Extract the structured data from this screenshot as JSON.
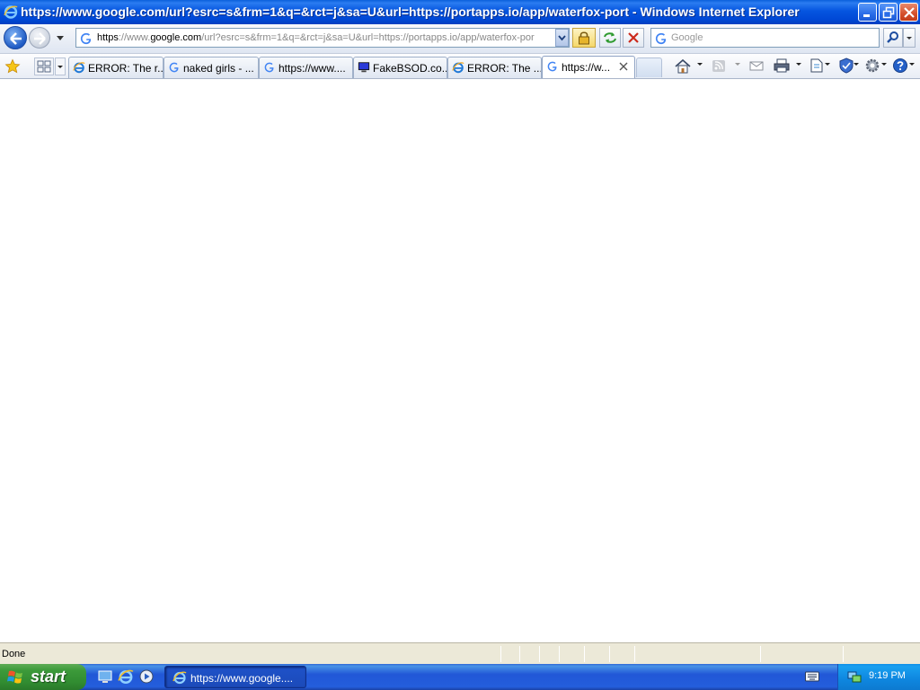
{
  "window": {
    "title": "https://www.google.com/url?esrc=s&frm=1&q=&rct=j&sa=U&url=https://portapps.io/app/waterfox-port - Windows Internet Explorer"
  },
  "navigation": {
    "url_scheme": "https",
    "url_sub": "://www.",
    "url_domain": "google.com",
    "url_rest": "/url?esrc=s&frm=1&q=&rct=j&sa=U&url=https://portapps.io/app/waterfox-por",
    "search_placeholder": "Google"
  },
  "tabs": [
    {
      "label": "ERROR: The r...",
      "icon": "ie-icon",
      "active": false
    },
    {
      "label": "naked girls - ...",
      "icon": "google-icon",
      "active": false
    },
    {
      "label": "https://www....",
      "icon": "google-icon",
      "active": false
    },
    {
      "label": "FakeBSOD.co...",
      "icon": "monitor-icon",
      "active": false
    },
    {
      "label": "ERROR: The ...",
      "icon": "ie-icon",
      "active": false
    },
    {
      "label": "https://w...",
      "icon": "google-icon",
      "active": true
    }
  ],
  "status": {
    "text": "Done"
  },
  "taskbar": {
    "start_label": "start",
    "task_label": "https://www.google....",
    "clock": "9:19 PM"
  },
  "colors": {
    "titlebar": "#0555e0",
    "taskbar": "#245edc",
    "start": "#3c9a3a",
    "tray": "#0e86df"
  }
}
